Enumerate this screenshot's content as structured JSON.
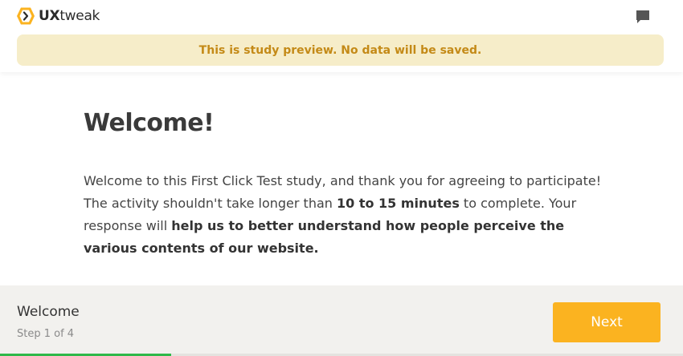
{
  "header": {
    "logo_prefix": "UX",
    "logo_suffix": "tweak",
    "logo_icon": "uxtweak-hexagon-logo",
    "chat_icon": "chat-bubble-icon"
  },
  "banner": {
    "text": "This is study preview. No data will be saved."
  },
  "main": {
    "title": "Welcome!",
    "paragraph": {
      "part1": "Welcome to this First Click Test study, and thank you for agreeing to participate! The activity shouldn't take longer than ",
      "bold1": "10 to 15 minutes",
      "part2": " to complete. Your response will ",
      "bold2": "help us to better understand how people perceive the various contents of our website."
    }
  },
  "footer": {
    "step_title": "Welcome",
    "step_count": "Step 1 of 4",
    "next_label": "Next"
  },
  "progress": {
    "fraction": 0.25
  },
  "colors": {
    "accent": "#fbb320",
    "banner_bg": "#f6edc9",
    "banner_text": "#c48a17",
    "progress": "#2fb84a",
    "footer_bg": "#f2f1ee"
  }
}
